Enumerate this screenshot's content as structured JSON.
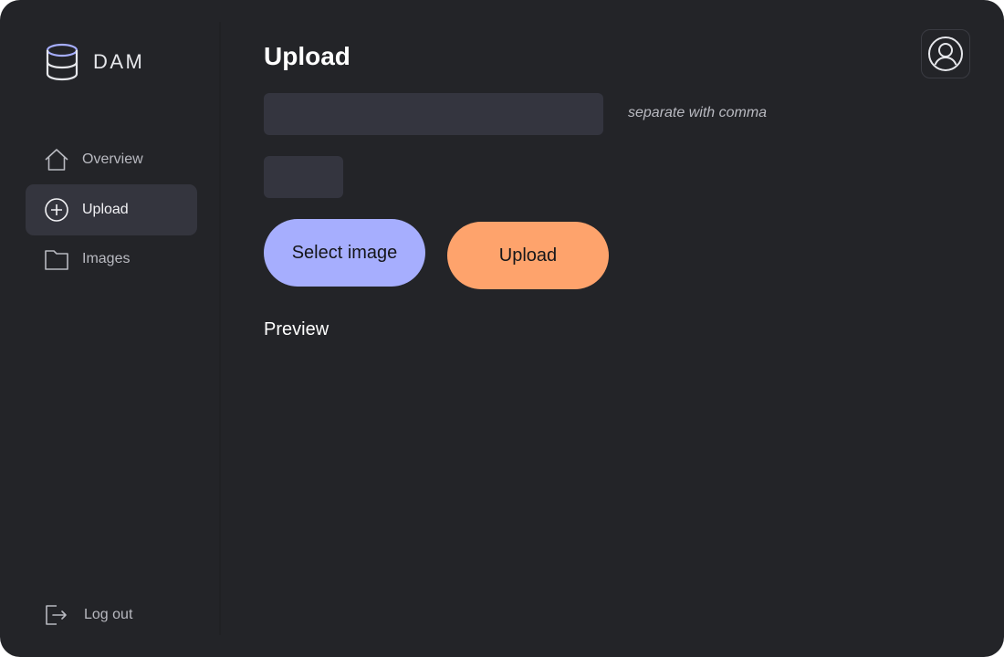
{
  "brand": {
    "name": "DAM",
    "icon": "database-icon"
  },
  "sidebar": {
    "items": [
      {
        "label": "Overview",
        "icon": "home-icon",
        "active": false
      },
      {
        "label": "Upload",
        "icon": "plus-circle-icon",
        "active": true
      },
      {
        "label": "Images",
        "icon": "folder-icon",
        "active": false
      }
    ],
    "logout": {
      "label": "Log out",
      "icon": "logout-icon"
    }
  },
  "main": {
    "title": "Upload",
    "tags_input": {
      "value": "",
      "placeholder": ""
    },
    "tags_hint": "separate with comma",
    "select_button": "Select image",
    "upload_button": "Upload",
    "preview_label": "Preview"
  },
  "header": {
    "avatar_icon": "user-avatar-icon"
  },
  "colors": {
    "background": "#232428",
    "active_nav": "#34353e",
    "input_bg": "#34353f",
    "select_button": "#a6aefe",
    "upload_button": "#fea36c",
    "brand_icon": "#a6aefe"
  }
}
